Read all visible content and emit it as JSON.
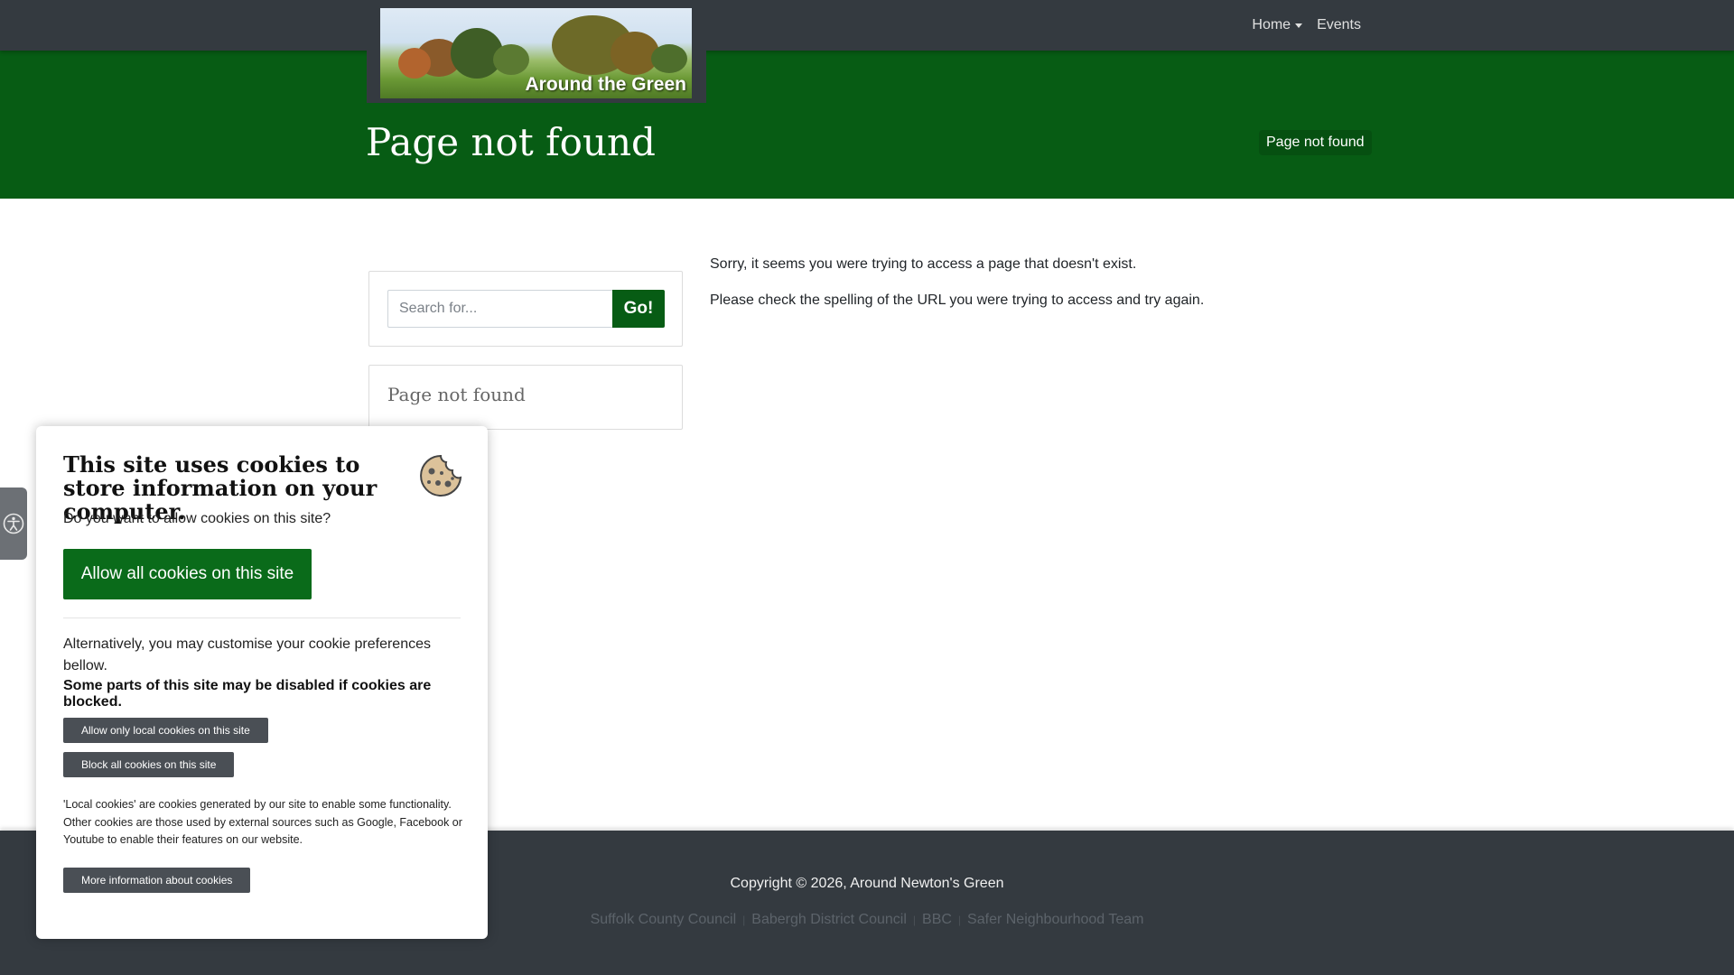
{
  "nav": {
    "home_label": "Home",
    "events_label": "Events"
  },
  "header": {
    "logo_text": "Around the Green",
    "page_title": "Page not found",
    "breadcrumb": "Page not found"
  },
  "sidebar": {
    "search_placeholder": "Search for...",
    "search_button": "Go!",
    "nav_title": "Page not found"
  },
  "main": {
    "line1": "Sorry, it seems you were trying to access a page that doesn't exist.",
    "line2": "Please check the spelling of the URL you were trying to access and try again."
  },
  "footer": {
    "copyright": "Copyright © 2026, Around Newton's Green",
    "links": [
      "Suffolk County Council",
      "Babergh District Council",
      "BBC",
      "Safer Neighbourhood Team"
    ]
  },
  "cookie": {
    "title": "This site uses cookies to store information on your computer.",
    "question": "Do you want to allow cookies on this site?",
    "allow_all": "Allow all cookies on this site",
    "alternative": "Alternatively, you may customise your cookie preferences bellow.",
    "warning": "Some parts of this site may be disabled if cookies are blocked.",
    "allow_local": "Allow only local cookies on this site",
    "block_all": "Block all cookies on this site",
    "note": "'Local cookies' are cookies generated by our site to enable some functionality. Other cookies are those used by external sources such as Google, Facebook or Youtube to enable their features on our website.",
    "more_info": "More information about cookies"
  },
  "colors": {
    "brand_green": "#075c14",
    "nav_dark": "#343a40",
    "button_green": "#0a6b1a"
  },
  "icons": {
    "accessibility": "accessibility-icon",
    "cookie": "cookie-icon",
    "dropdown": "caret-down-icon"
  }
}
